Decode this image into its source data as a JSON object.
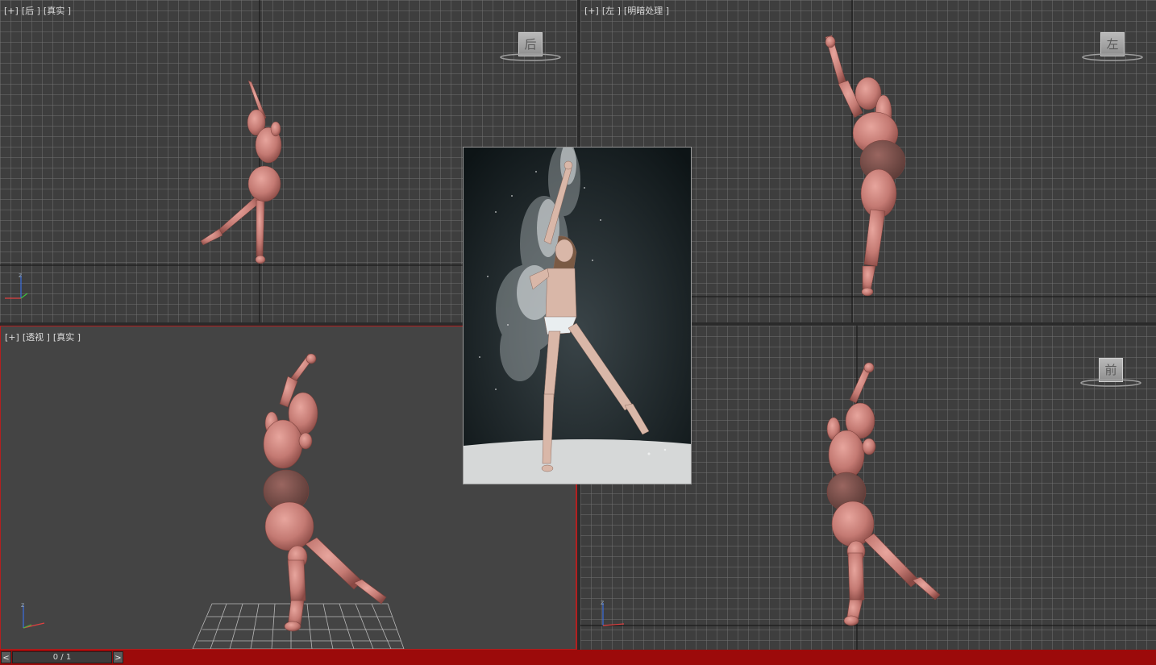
{
  "viewports": {
    "back": {
      "labels": [
        "[+]",
        "[后 ]",
        "[真实 ]"
      ],
      "viewcube_label": "后"
    },
    "left": {
      "labels": [
        "[+]",
        "[左 ]",
        "[明暗处理 ]"
      ],
      "viewcube_label": "左"
    },
    "perspective": {
      "labels": [
        "[+]",
        "[透视 ]",
        "[真实 ]"
      ]
    },
    "front": {
      "viewcube_label": "前"
    }
  },
  "axes": {
    "x": "x",
    "y": "y",
    "z": "z"
  },
  "timeline": {
    "prev_label": "<",
    "next_label": ">",
    "frame_readout": "0 / 1"
  },
  "colors": {
    "grid_bg": "#3e3e3e",
    "grid_line": "#6f6f6f",
    "perspective_bg": "#454545",
    "mannequin": "#c9807a",
    "active_border": "#b21f1f",
    "timeline_bar": "#9c0a0a"
  }
}
